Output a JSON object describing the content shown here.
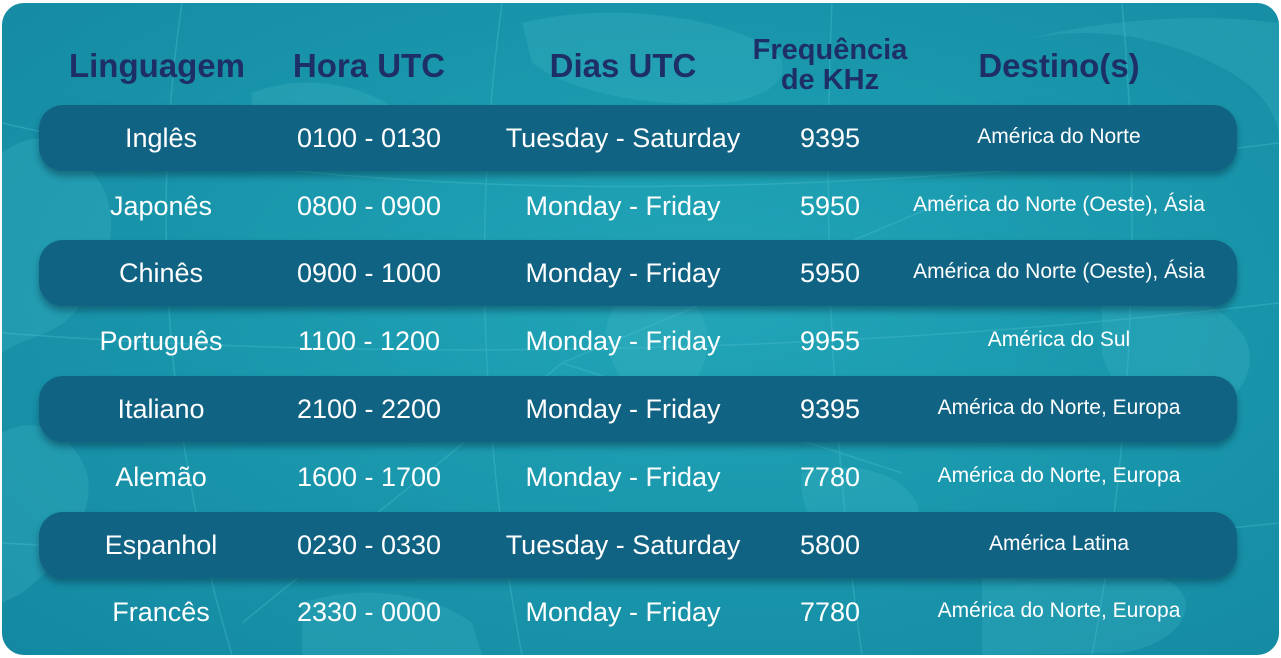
{
  "table": {
    "headers": {
      "language": "Linguagem",
      "hour": "Hora UTC",
      "days": "Dias UTC",
      "frequency_line1": "Frequência",
      "frequency_line2": "de KHz",
      "destination": "Destino(s)"
    },
    "rows": [
      {
        "language": "Inglês",
        "hour": "0100 - 0130",
        "days": "Tuesday - Saturday",
        "frequency": "9395",
        "destination": "América do Norte"
      },
      {
        "language": "Japonês",
        "hour": "0800 - 0900",
        "days": "Monday - Friday",
        "frequency": "5950",
        "destination": "América do Norte (Oeste), Ásia"
      },
      {
        "language": "Chinês",
        "hour": "0900 - 1000",
        "days": "Monday - Friday",
        "frequency": "5950",
        "destination": "América do Norte (Oeste), Ásia"
      },
      {
        "language": "Português",
        "hour": "1100 - 1200",
        "days": "Monday - Friday",
        "frequency": "9955",
        "destination": "América do Sul"
      },
      {
        "language": "Italiano",
        "hour": "2100 - 2200",
        "days": "Monday - Friday",
        "frequency": "9395",
        "destination": "América do Norte, Europa"
      },
      {
        "language": "Alemão",
        "hour": "1600 - 1700",
        "days": "Monday - Friday",
        "frequency": "7780",
        "destination": "América do Norte, Europa"
      },
      {
        "language": "Espanhol",
        "hour": "0230 - 0330",
        "days": "Tuesday - Saturday",
        "frequency": "5800",
        "destination": "América Latina"
      },
      {
        "language": "Francês",
        "hour": "2330 - 0000",
        "days": "Monday - Friday",
        "frequency": "7780",
        "destination": "América do Norte, Europa"
      }
    ]
  },
  "colors": {
    "background": "#1a98ad",
    "row_band": "#106383",
    "header_text": "#1d2f66",
    "body_text": "#ffffff"
  }
}
